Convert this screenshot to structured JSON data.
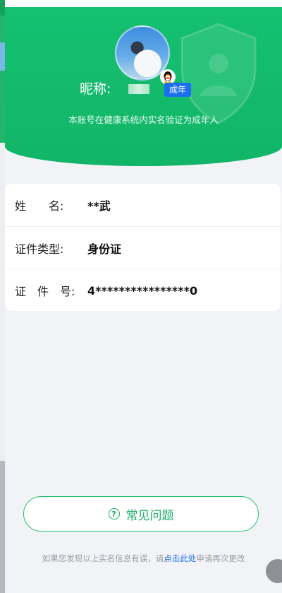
{
  "profile": {
    "nickname_label": "昵称:",
    "adult_badge": "成年",
    "verify_note": "本账号在健康系统内实名验证为成年人"
  },
  "info_rows": [
    {
      "label": "姓　　名:",
      "value": "**武"
    },
    {
      "label": "证件类型:",
      "value": "身份证"
    },
    {
      "label": "证　件　号:",
      "value": "4****************0"
    }
  ],
  "faq": {
    "label": "常见问题"
  },
  "footer": {
    "prefix": "如果您发现以上实名信息有误，请",
    "link": "点击此处",
    "suffix": "申请再次更改"
  },
  "colors": {
    "brand_green": "#15c071",
    "badge_blue": "#1d6ff2",
    "link_blue": "#1d6ff2"
  },
  "icons": [
    "shield-icon",
    "qq-penguin-icon",
    "question-circle-icon"
  ]
}
